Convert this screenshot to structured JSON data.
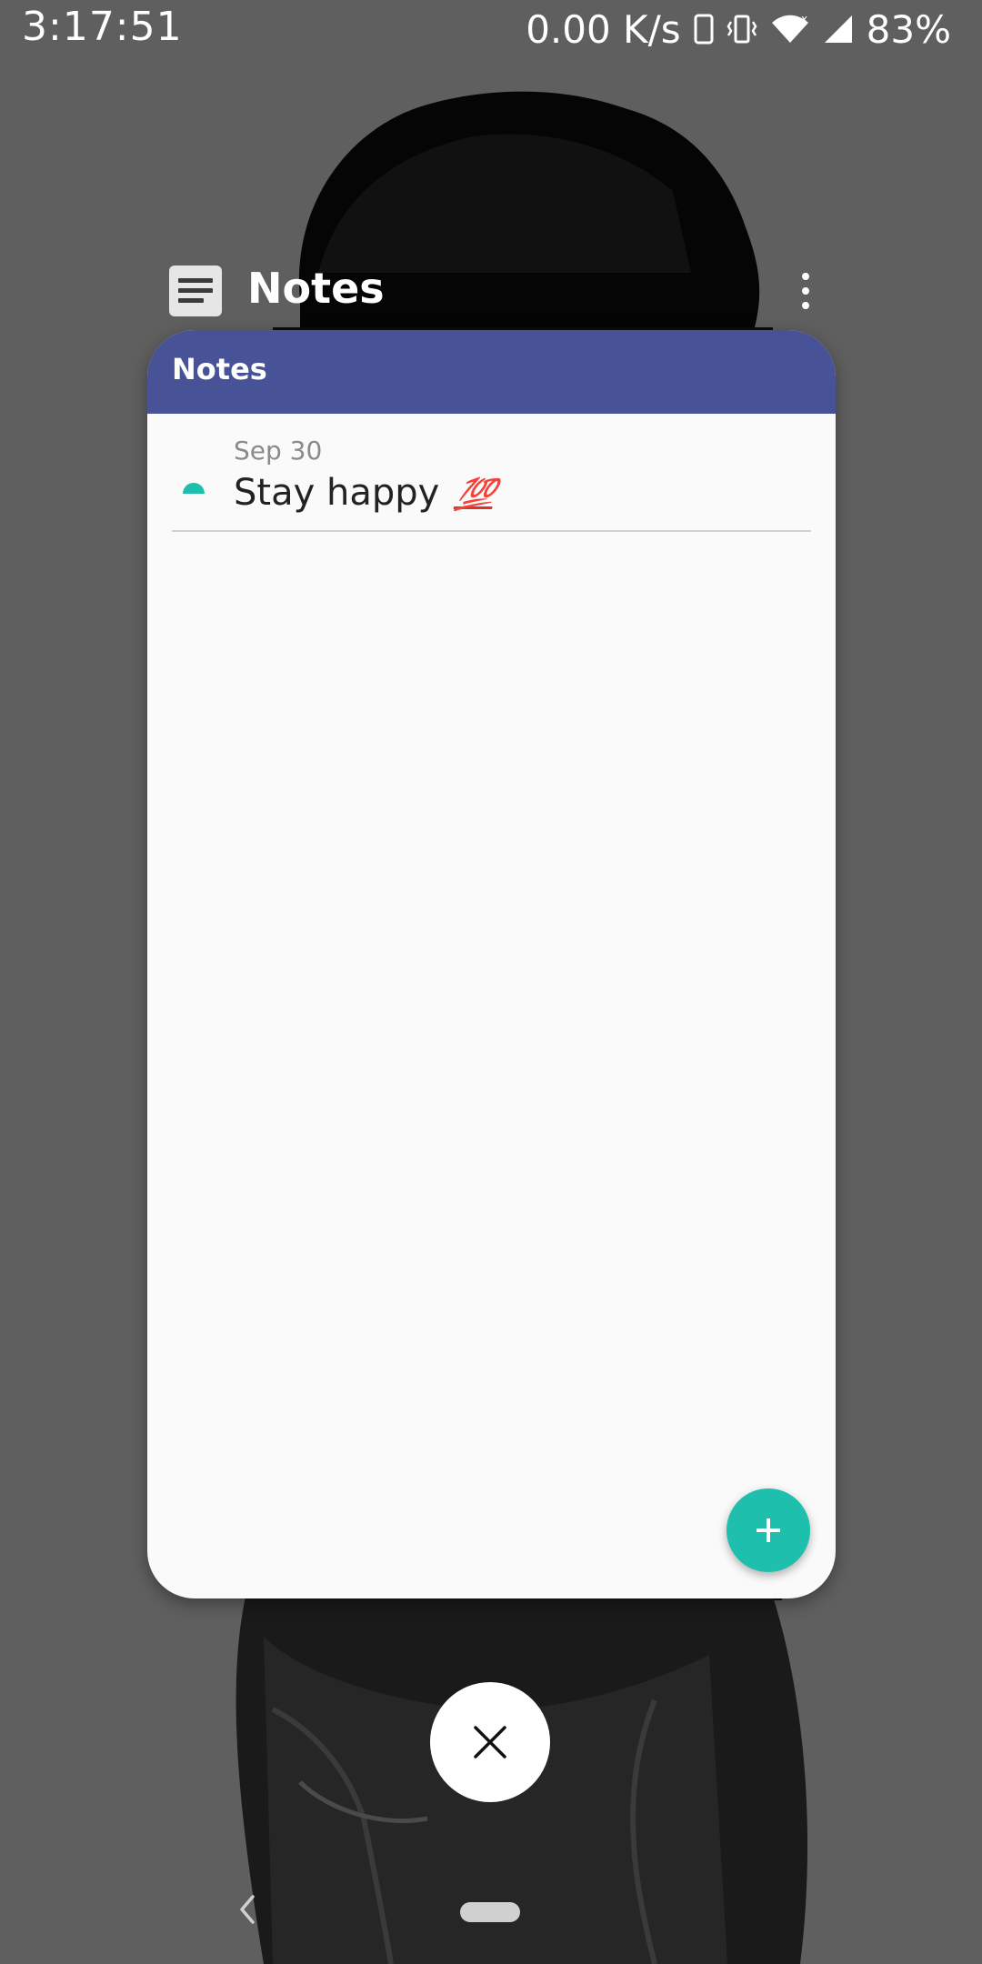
{
  "status_bar": {
    "time": "3:17:51",
    "network_speed": "0.00 K/s",
    "battery": "83%",
    "icons": [
      "phone-icon",
      "vibrate-icon",
      "wifi-icon",
      "signal-icon"
    ]
  },
  "recents": {
    "app_name": "Notes",
    "app_icon": "notes-app-icon",
    "menu_icon": "more-vert-icon"
  },
  "app": {
    "toolbar_title": "Notes",
    "toolbar_color": "#475297",
    "accent_color": "#1fbfad",
    "notes": [
      {
        "date": "Sep 30",
        "title": "Stay happy",
        "emoji": "💯"
      }
    ],
    "fab_icon": "plus-icon"
  },
  "clear_button": {
    "icon": "close-icon"
  },
  "nav": {
    "back_icon": "back-chevron-icon",
    "home_icon": "home-pill-icon"
  }
}
